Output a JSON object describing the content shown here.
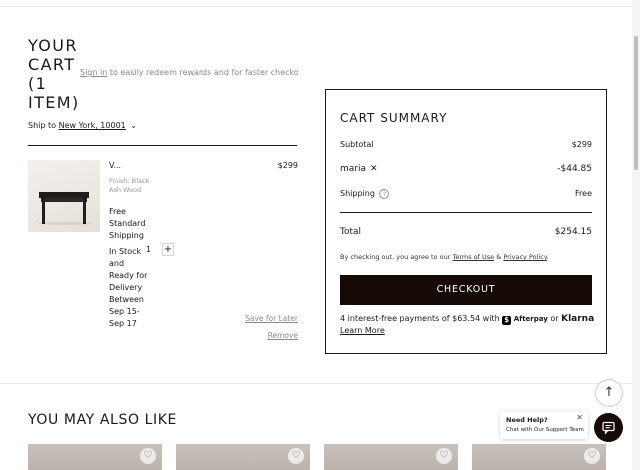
{
  "cart": {
    "title": "YOUR CART (1 ITEM)",
    "signin_link": "Sign in",
    "signin_text": "to easily redeem rewards and for faster checkout",
    "ship_to_label": "Ship to",
    "ship_to_location": "New York, 10001",
    "item": {
      "name": "V...",
      "finish": "Finish: Black Ash Wood",
      "price": "$299",
      "shipping": "Free Standard Shipping",
      "stock": "In Stock and Ready for Delivery Between Sep 15-Sep 17",
      "quantity": "1",
      "quantity_plus": "+",
      "save_for_later": "Save for Later",
      "remove": "Remove"
    }
  },
  "summary": {
    "title": "CART SUMMARY",
    "subtotal_label": "Subtotal",
    "subtotal_value": "$299",
    "promo_code": "maria",
    "promo_remove": "✕",
    "promo_value": "-$44.85",
    "shipping_label": "Shipping",
    "shipping_help": "?",
    "shipping_value": "Free",
    "total_label": "Total",
    "total_value": "$254.15",
    "agree_prefix": "By checking out, you agree to our",
    "terms_link": "Terms of Use",
    "agree_and": "&",
    "privacy_link": "Privacy Policy",
    "agree_suffix": ".",
    "checkout_label": "CHECKOUT",
    "payments_text": "4 interest-free payments of $63.54 with",
    "afterpay_badge": "$",
    "afterpay_label": "Afterpay",
    "or_text": "or",
    "klarna_label": "Klarna",
    "learn_more": "Learn More"
  },
  "recommendations": {
    "title": "YOU MAY ALSO LIKE",
    "tiles": [
      {
        "heart": "♡"
      },
      {
        "heart": "♡"
      },
      {
        "heart": "♡"
      },
      {
        "heart": "♡"
      }
    ]
  },
  "support": {
    "scroll_top_icon": "↑",
    "help_title": "Need Help?",
    "help_subtitle": "Chat with Our Support Team",
    "help_close": "✕"
  },
  "icons": {
    "chevron": "chevron-down-icon",
    "scroll_top": "arrow-up-icon",
    "chat": "chat-icon",
    "heart": "heart-icon"
  },
  "colors": {
    "checkout_bg": "#160a06",
    "text": "#1a1a1a",
    "muted": "#8a8a8a"
  }
}
